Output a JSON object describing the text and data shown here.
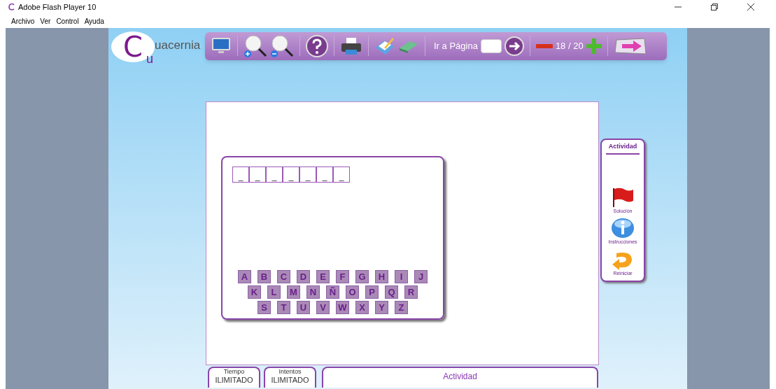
{
  "window": {
    "title": "Adobe Flash Player 10"
  },
  "menu": [
    "Archivo",
    "Ver",
    "Control",
    "Ayuda"
  ],
  "logo": {
    "letter": "C",
    "sub": "u",
    "name": "uacernia"
  },
  "toolbar": {
    "goto_label": "Ir a Página",
    "page": "18 / 20"
  },
  "slots": [
    "_",
    "_",
    "_",
    "_",
    "_",
    "_",
    "_"
  ],
  "keyboard": [
    [
      "A",
      "B",
      "C",
      "D",
      "E",
      "F",
      "G",
      "H",
      "I",
      "J"
    ],
    [
      "K",
      "L",
      "M",
      "N",
      "Ñ",
      "O",
      "P",
      "Q",
      "R"
    ],
    [
      "S",
      "T",
      "U",
      "V",
      "W",
      "X",
      "Y",
      "Z"
    ]
  ],
  "side_panel": {
    "title": "Actividad",
    "actions": [
      {
        "kind": "flag",
        "label": "Solución"
      },
      {
        "kind": "info",
        "label": "Instrucciones"
      },
      {
        "kind": "restart",
        "label": "Reiniciar"
      }
    ]
  },
  "footer": [
    {
      "kind": "stat",
      "label": "Tiempo",
      "value": "ILIMITADO"
    },
    {
      "kind": "stat",
      "label": "Intentos",
      "value": "ILIMITADO"
    },
    {
      "kind": "title",
      "label": "Actividad"
    }
  ]
}
